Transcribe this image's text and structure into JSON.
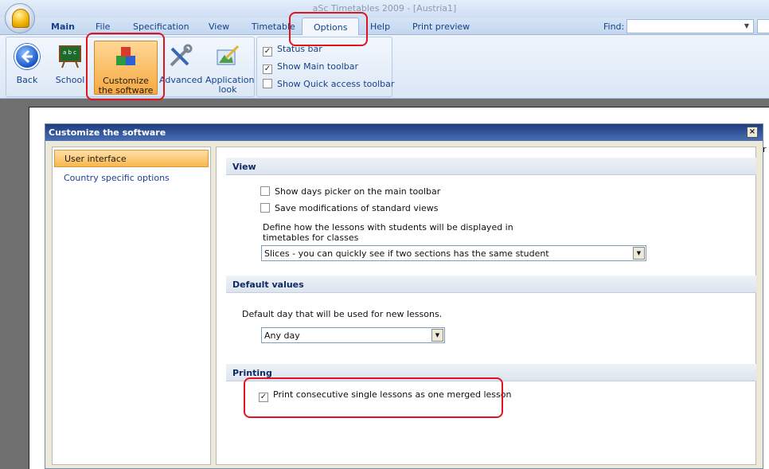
{
  "window": {
    "title": "aSc Timetables 2009  - [Austria1]"
  },
  "tabs": [
    {
      "label": "Main"
    },
    {
      "label": "File"
    },
    {
      "label": "Specification"
    },
    {
      "label": "View"
    },
    {
      "label": "Timetable"
    },
    {
      "label": "Options"
    },
    {
      "label": "Help"
    },
    {
      "label": "Print preview"
    }
  ],
  "find": {
    "label": "Find:",
    "value": ""
  },
  "ribbon": {
    "back": "Back",
    "school": "School",
    "customize": "Customize the software",
    "advanced": "Advanced",
    "application_look": "Application look",
    "checks": [
      {
        "label": "Status bar",
        "checked": true
      },
      {
        "label": "Show Main toolbar",
        "checked": true
      },
      {
        "label": "Show Quick access toolbar",
        "checked": false
      }
    ]
  },
  "dialog": {
    "title": "Customize the software",
    "close": "×",
    "stub": "r",
    "nav": [
      {
        "label": "User interface",
        "selected": true
      },
      {
        "label": "Country specific options",
        "selected": false
      }
    ],
    "sections": {
      "view": {
        "title": "View",
        "opt1": "Show days picker on the main toolbar",
        "opt2": "Save modifications of standard views",
        "define_line1": "Define how the lessons with students will be displayed in",
        "define_line2": "timetables for classes",
        "combo": "Slices - you can quickly see if two sections has the same student"
      },
      "defaults": {
        "title": "Default values",
        "label": "Default day that will be used for new lessons.",
        "combo": "Any day"
      },
      "printing": {
        "title": "Printing",
        "opt": "Print consecutive single lessons as one merged lesson",
        "checked": true
      }
    }
  },
  "colors": {
    "highlight": "#e0141e",
    "ribbon_text": "#15428b",
    "dialog_title": "#1d3d7e"
  }
}
